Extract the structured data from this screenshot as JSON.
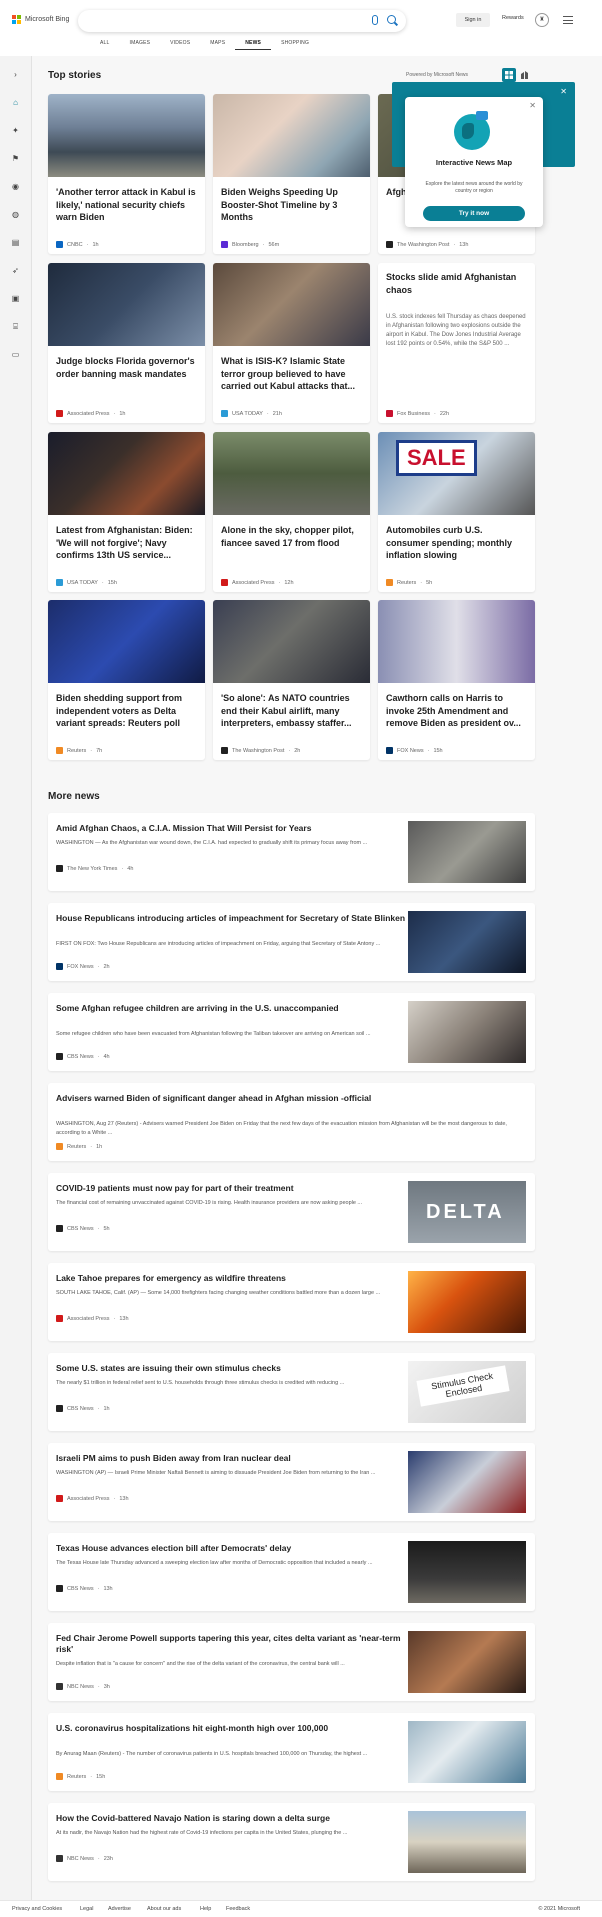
{
  "header": {
    "logo_text": "Microsoft Bing",
    "signin_label": "Sign in",
    "rewards_label": "Rewards",
    "search_placeholder": ""
  },
  "nav_tabs": [
    {
      "label": "ALL"
    },
    {
      "label": "IMAGES"
    },
    {
      "label": "VIDEOS"
    },
    {
      "label": "MAPS"
    },
    {
      "label": "NEWS",
      "active": true
    },
    {
      "label": "SHOPPING"
    }
  ],
  "left_rail_icons": [
    "chevron-right-icon",
    "home-icon",
    "sparkle-icon",
    "flag-icon",
    "location-icon",
    "globe-icon",
    "business-icon",
    "rocket-icon",
    "entertainment-icon",
    "politics-icon",
    "video-icon"
  ],
  "top_stories": {
    "title": "Top stories",
    "powered_by": "Powered by Microsoft News",
    "cards": [
      {
        "title": "'Another terror attack in Kabul is likely,' national security chiefs warn Biden",
        "source": "CNBC",
        "time": "1h",
        "logo_color": "#0a66c2",
        "image": "kabul"
      },
      {
        "title": "Biden Weighs Speeding Up Booster-Shot Timeline by 3 Months",
        "source": "Bloomberg",
        "time": "56m",
        "logo_color": "#5b2bd5",
        "image": "vaccine"
      },
      {
        "title": "Afgh... force... attac...",
        "source": "The Washington Post",
        "time": "13h",
        "logo_color": "#222",
        "image": "soldiers"
      },
      {
        "title": "Judge blocks Florida governor's order banning mask mandates",
        "source": "Associated Press",
        "time": "1h",
        "logo_color": "#d11a1a",
        "image": "desantis"
      },
      {
        "title": "What is ISIS-K? Islamic State terror group believed to have carried out Kabul attacks that...",
        "source": "USA TODAY",
        "time": "21h",
        "logo_color": "#2b9bd6",
        "image": "crowd"
      },
      {
        "title": "Stocks slide amid Afghanistan chaos",
        "snippet": "U.S. stock indexes fell Thursday as chaos deepened in Afghanistan following two explosions outside the airport in Kabul. The Dow Jones Industrial Average lost 192 points or 0.54%, while the S&P 500 ...",
        "source": "Fox Business",
        "time": "22h",
        "logo_color": "#c8102e",
        "text_only": true
      },
      {
        "title": "Latest from Afghanistan: Biden: 'We will not forgive'; Navy confirms 13th US service...",
        "source": "USA TODAY",
        "time": "15h",
        "logo_color": "#2b9bd6",
        "image": "night"
      },
      {
        "title": "Alone in the sky, chopper pilot, fiancee saved 17 from flood",
        "source": "Associated Press",
        "time": "12h",
        "logo_color": "#d11a1a",
        "image": "helicopter"
      },
      {
        "title": "Automobiles curb U.S. consumer spending; monthly inflation slowing",
        "source": "Reuters",
        "time": "5h",
        "logo_color": "#f08a24",
        "image": "sale"
      },
      {
        "title": "Biden shedding support from independent voters as Delta variant spreads: Reuters poll",
        "source": "Reuters",
        "time": "7h",
        "logo_color": "#f08a24",
        "image": "biden"
      },
      {
        "title": "'So alone': As NATO countries end their Kabul airlift, many interpreters, embassy staffer...",
        "source": "The Washington Post",
        "time": "2h",
        "logo_color": "#222",
        "image": "airport"
      },
      {
        "title": "Cawthorn calls on Harris to invoke 25th Amendment and remove Biden as president ov...",
        "source": "FOX News",
        "time": "15h",
        "logo_color": "#003366",
        "image": "harris"
      }
    ]
  },
  "popup": {
    "title": "Interactive News Map",
    "body": "Explore the latest news around the world by country or region",
    "button": "Try it now"
  },
  "more_news": {
    "title": "More news",
    "items": [
      {
        "title": "Amid Afghan Chaos, a C.I.A. Mission That Will Persist for Years",
        "snippet": "WASHINGTON — As the Afghanistan war wound down, the C.I.A. had expected to gradually shift its primary focus away from ...",
        "source": "The New York Times",
        "time": "4h",
        "logo_color": "#222",
        "thumb": "military"
      },
      {
        "title": "House Republicans introducing articles of impeachment for Secretary of State Blinken",
        "snippet": "FIRST ON FOX: Two House Republicans are introducing articles of impeachment on Friday, arguing that Secretary of State Antony ...",
        "source": "FOX News",
        "time": "2h",
        "logo_color": "#003366",
        "thumb": "blinken"
      },
      {
        "title": "Some Afghan refugee children are arriving in the U.S. unaccompanied",
        "snippet": "Some refugee children who have been evacuated from Afghanistan following the Taliban takeover are arriving on American soil ...",
        "source": "CBS News",
        "time": "4h",
        "logo_color": "#222",
        "thumb": "refugee"
      },
      {
        "title": "Advisers warned Biden of significant danger ahead in Afghan mission -official",
        "snippet": "WASHINGTON, Aug 27 (Reuters) - Advisers warned President Joe Biden on Friday that the next few days of the evacuation mission from Afghanistan will be the most dangerous to date, according to a White ...",
        "source": "Reuters",
        "time": "1h",
        "logo_color": "#f08a24",
        "thumb": ""
      },
      {
        "title": "COVID-19 patients must now pay for part of their treatment",
        "snippet": "The financial cost of remaining unvaccinated against COVID-19 is rising. Health insurance providers are now asking people ...",
        "source": "CBS News",
        "time": "5h",
        "logo_color": "#222",
        "thumb": "delta",
        "thumb_text": "DELTA"
      },
      {
        "title": "Lake Tahoe prepares for emergency as wildfire threatens",
        "snippet": "SOUTH LAKE TAHOE, Calif. (AP) — Some 14,000 firefighters facing changing weather conditions battled more than a dozen large ...",
        "source": "Associated Press",
        "time": "13h",
        "logo_color": "#d11a1a",
        "thumb": "fire"
      },
      {
        "title": "Some U.S. states are issuing their own stimulus checks",
        "snippet": "The nearly $1 trillion in federal relief sent to U.S. households through three stimulus checks is credited with reducing ...",
        "source": "CBS News",
        "time": "1h",
        "logo_color": "#222",
        "thumb": "stimulus",
        "thumb_text": "Stimulus Check Enclosed"
      },
      {
        "title": "Israeli PM aims to push Biden away from Iran nuclear deal",
        "snippet": "WASHINGTON (AP) — Israeli Prime Minister Naftali Bennett is aiming to dissuade President Joe Biden from returning to the Iran ...",
        "source": "Associated Press",
        "time": "13h",
        "logo_color": "#d11a1a",
        "thumb": "bennett"
      },
      {
        "title": "Texas House advances election bill after Democrats' delay",
        "snippet": "The Texas House late Thursday advanced a sweeping election law after months of Democratic opposition that included a nearly ...",
        "source": "CBS News",
        "time": "13h",
        "logo_color": "#222",
        "thumb": "board"
      },
      {
        "title": "Fed Chair Jerome Powell supports tapering this year, cites delta variant as 'near-term risk'",
        "snippet": "Despite inflation that is \"a cause for concern\" and the rise of the delta variant of the coronavirus, the central bank will ...",
        "source": "NBC News",
        "time": "3h",
        "logo_color": "#333",
        "thumb": "powell"
      },
      {
        "title": "U.S. coronavirus hospitalizations hit eight-month high over 100,000",
        "snippet": "By Anurag Maan (Reuters) - The number of coronavirus patients in U.S. hospitals breached 100,000 on Thursday, the highest ...",
        "source": "Reuters",
        "time": "15h",
        "logo_color": "#f08a24",
        "thumb": "hospital"
      },
      {
        "title": "How the Covid-battered Navajo Nation is staring down a delta surge",
        "snippet": "At its nadir, the Navajo Nation had the highest rate of Covid-19 infections per capita in the United States, plunging the ...",
        "source": "NBC News",
        "time": "23h",
        "logo_color": "#333",
        "thumb": "navajo"
      }
    ]
  },
  "footer": {
    "links": [
      "Privacy and Cookies",
      "Legal",
      "Advertise",
      "About our ads",
      "Help",
      "Feedback"
    ],
    "copyright": "© 2021 Microsoft"
  }
}
